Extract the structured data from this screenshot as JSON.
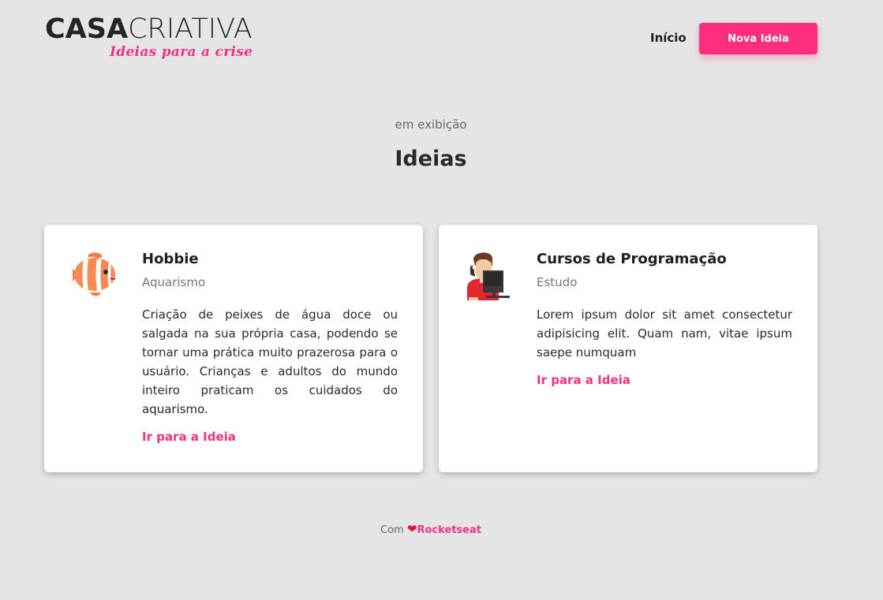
{
  "header": {
    "logo_main_bold": "CASA",
    "logo_main_light": "CRIATIVA",
    "logo_sub": "Ideias para a crise",
    "nav_home": "Início",
    "new_idea_button": "Nova Ideia"
  },
  "section": {
    "kicker": "em exibição",
    "title": "Ideias"
  },
  "ideas": [
    {
      "title": "Hobbie",
      "category": "Aquarismo",
      "description": "Criação de peixes de água doce ou salgada na sua própria casa, podendo se tornar uma prática muito prazerosa para o usuário. Crianças e adultos do mundo inteiro praticam os cuidados do aquarismo.",
      "link": "Ir para a Ideia",
      "icon": "fish-icon"
    },
    {
      "title": "Cursos de Programação",
      "category": "Estudo",
      "description": "Lorem ipsum dolor sit amet consectetur adipisicing elit. Quam nam, vitae ipsum saepe numquam",
      "link": "Ir para a Ideia",
      "icon": "programmer-icon"
    }
  ],
  "footer": {
    "prefix": "Com",
    "heart": "❤",
    "brand": "Rocketseat"
  },
  "colors": {
    "accent": "#ff2d7b",
    "background": "#e5e5e5",
    "card": "#ffffff"
  }
}
